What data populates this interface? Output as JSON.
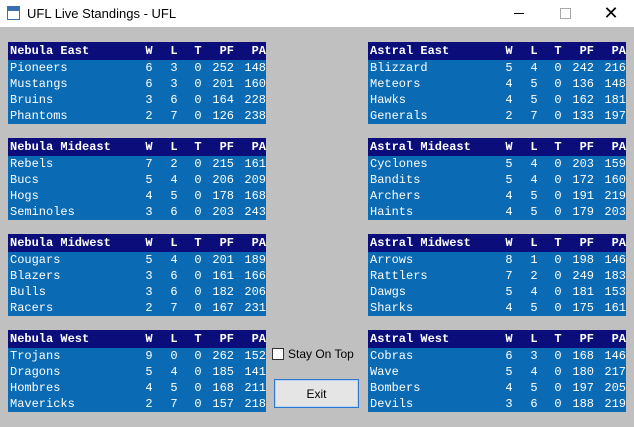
{
  "window": {
    "title": "UFL Live Standings - UFL",
    "minimize": "—",
    "maximize": "☐",
    "close": "✕"
  },
  "columns": {
    "w": "W",
    "l": "L",
    "t": "T",
    "pf": "PF",
    "pa": "PA"
  },
  "divisions": [
    {
      "name": "Nebula East",
      "teams": [
        {
          "team": "Pioneers",
          "w": "6",
          "l": "3",
          "t": "0",
          "pf": "252",
          "pa": "148"
        },
        {
          "team": "Mustangs",
          "w": "6",
          "l": "3",
          "t": "0",
          "pf": "201",
          "pa": "160"
        },
        {
          "team": "Bruins",
          "w": "3",
          "l": "6",
          "t": "0",
          "pf": "164",
          "pa": "228"
        },
        {
          "team": "Phantoms",
          "w": "2",
          "l": "7",
          "t": "0",
          "pf": "126",
          "pa": "238"
        }
      ]
    },
    {
      "name": "Astral East",
      "teams": [
        {
          "team": "Blizzard",
          "w": "5",
          "l": "4",
          "t": "0",
          "pf": "242",
          "pa": "216"
        },
        {
          "team": "Meteors",
          "w": "4",
          "l": "5",
          "t": "0",
          "pf": "136",
          "pa": "148"
        },
        {
          "team": "Hawks",
          "w": "4",
          "l": "5",
          "t": "0",
          "pf": "162",
          "pa": "181"
        },
        {
          "team": "Generals",
          "w": "2",
          "l": "7",
          "t": "0",
          "pf": "133",
          "pa": "197"
        }
      ]
    },
    {
      "name": "Nebula Mideast",
      "teams": [
        {
          "team": "Rebels",
          "w": "7",
          "l": "2",
          "t": "0",
          "pf": "215",
          "pa": "161"
        },
        {
          "team": "Bucs",
          "w": "5",
          "l": "4",
          "t": "0",
          "pf": "206",
          "pa": "209"
        },
        {
          "team": "Hogs",
          "w": "4",
          "l": "5",
          "t": "0",
          "pf": "178",
          "pa": "168"
        },
        {
          "team": "Seminoles",
          "w": "3",
          "l": "6",
          "t": "0",
          "pf": "203",
          "pa": "243"
        }
      ]
    },
    {
      "name": "Astral Mideast",
      "teams": [
        {
          "team": "Cyclones",
          "w": "5",
          "l": "4",
          "t": "0",
          "pf": "203",
          "pa": "159"
        },
        {
          "team": "Bandits",
          "w": "5",
          "l": "4",
          "t": "0",
          "pf": "172",
          "pa": "160"
        },
        {
          "team": "Archers",
          "w": "4",
          "l": "5",
          "t": "0",
          "pf": "191",
          "pa": "219"
        },
        {
          "team": "Haints",
          "w": "4",
          "l": "5",
          "t": "0",
          "pf": "179",
          "pa": "203"
        }
      ]
    },
    {
      "name": "Nebula Midwest",
      "teams": [
        {
          "team": "Cougars",
          "w": "5",
          "l": "4",
          "t": "0",
          "pf": "201",
          "pa": "189"
        },
        {
          "team": "Blazers",
          "w": "3",
          "l": "6",
          "t": "0",
          "pf": "161",
          "pa": "166"
        },
        {
          "team": "Bulls",
          "w": "3",
          "l": "6",
          "t": "0",
          "pf": "182",
          "pa": "206"
        },
        {
          "team": "Racers",
          "w": "2",
          "l": "7",
          "t": "0",
          "pf": "167",
          "pa": "231"
        }
      ]
    },
    {
      "name": "Astral Midwest",
      "teams": [
        {
          "team": "Arrows",
          "w": "8",
          "l": "1",
          "t": "0",
          "pf": "198",
          "pa": "146"
        },
        {
          "team": "Rattlers",
          "w": "7",
          "l": "2",
          "t": "0",
          "pf": "249",
          "pa": "183"
        },
        {
          "team": "Dawgs",
          "w": "5",
          "l": "4",
          "t": "0",
          "pf": "181",
          "pa": "153"
        },
        {
          "team": "Sharks",
          "w": "4",
          "l": "5",
          "t": "0",
          "pf": "175",
          "pa": "161"
        }
      ]
    },
    {
      "name": "Nebula West",
      "teams": [
        {
          "team": "Trojans",
          "w": "9",
          "l": "0",
          "t": "0",
          "pf": "262",
          "pa": "152"
        },
        {
          "team": "Dragons",
          "w": "5",
          "l": "4",
          "t": "0",
          "pf": "185",
          "pa": "141"
        },
        {
          "team": "Hombres",
          "w": "4",
          "l": "5",
          "t": "0",
          "pf": "168",
          "pa": "211"
        },
        {
          "team": "Mavericks",
          "w": "2",
          "l": "7",
          "t": "0",
          "pf": "157",
          "pa": "218"
        }
      ]
    },
    {
      "name": "Astral West",
      "teams": [
        {
          "team": "Cobras",
          "w": "6",
          "l": "3",
          "t": "0",
          "pf": "168",
          "pa": "146"
        },
        {
          "team": "Wave",
          "w": "5",
          "l": "4",
          "t": "0",
          "pf": "180",
          "pa": "217"
        },
        {
          "team": "Bombers",
          "w": "4",
          "l": "5",
          "t": "0",
          "pf": "197",
          "pa": "205"
        },
        {
          "team": "Devils",
          "w": "3",
          "l": "6",
          "t": "0",
          "pf": "188",
          "pa": "219"
        }
      ]
    }
  ],
  "controls": {
    "stay_on_top_label": "Stay On Top",
    "stay_on_top_checked": false,
    "exit_label": "Exit"
  },
  "colors": {
    "panel_bg": "#0a6bb4",
    "header_bg": "#0b0e7a",
    "window_bg": "#c0c0c0"
  }
}
